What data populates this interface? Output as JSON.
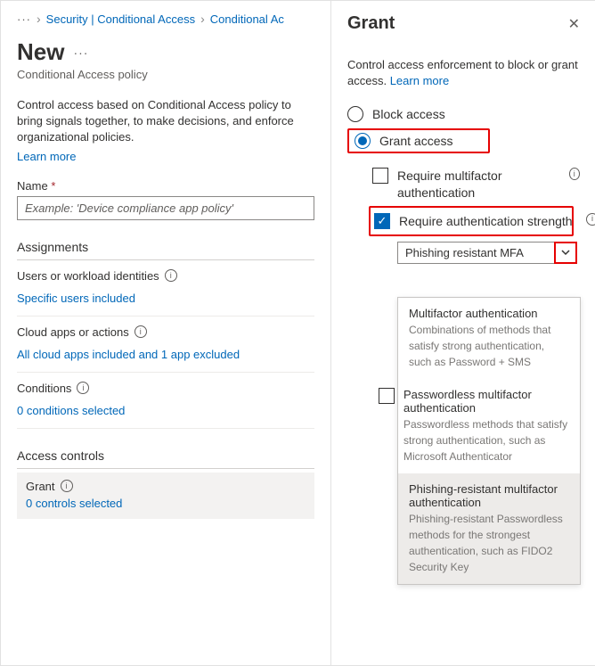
{
  "breadcrumb": {
    "ellipsis": "···",
    "item1": "Security | Conditional Access",
    "item2": "Conditional Ac"
  },
  "page": {
    "title": "New",
    "moreDots": "···",
    "subtitle": "Conditional Access policy",
    "intro": "Control access based on Conditional Access policy to bring signals together, to make decisions, and enforce organizational policies.",
    "learnMore": "Learn more"
  },
  "nameField": {
    "label": "Name",
    "required": "*",
    "placeholder": "Example: 'Device compliance app policy'"
  },
  "sections": {
    "assignments": "Assignments",
    "users": {
      "label": "Users or workload identities",
      "link": "Specific users included"
    },
    "apps": {
      "label": "Cloud apps or actions",
      "link": "All cloud apps included and 1 app excluded"
    },
    "conditions": {
      "label": "Conditions",
      "link": "0 conditions selected"
    },
    "controls": "Access controls",
    "grant": {
      "label": "Grant",
      "link": "0 controls selected"
    }
  },
  "panel": {
    "title": "Grant",
    "intro": "Control access enforcement to block or grant access.",
    "learnMore": "Learn more",
    "block": "Block access",
    "grant": "Grant access",
    "reqMfa": "Require multifactor authentication",
    "reqStrength": "Require authentication strength",
    "ddValue": "Phishing resistant MFA",
    "dd": {
      "opt1": {
        "title": "Multifactor authentication",
        "desc": "Combinations of methods that satisfy strong authentication, such as Password + SMS"
      },
      "check2": "Passwordless multifactor authentication",
      "opt2desc": "Passwordless methods that satisfy strong authentication, such as Microsoft Authenticator",
      "opt3": {
        "title": "Phishing-resistant multifactor authentication",
        "desc": "Phishing-resistant Passwordless methods for the strongest authentication, such as FIDO2 Security Key"
      }
    }
  }
}
